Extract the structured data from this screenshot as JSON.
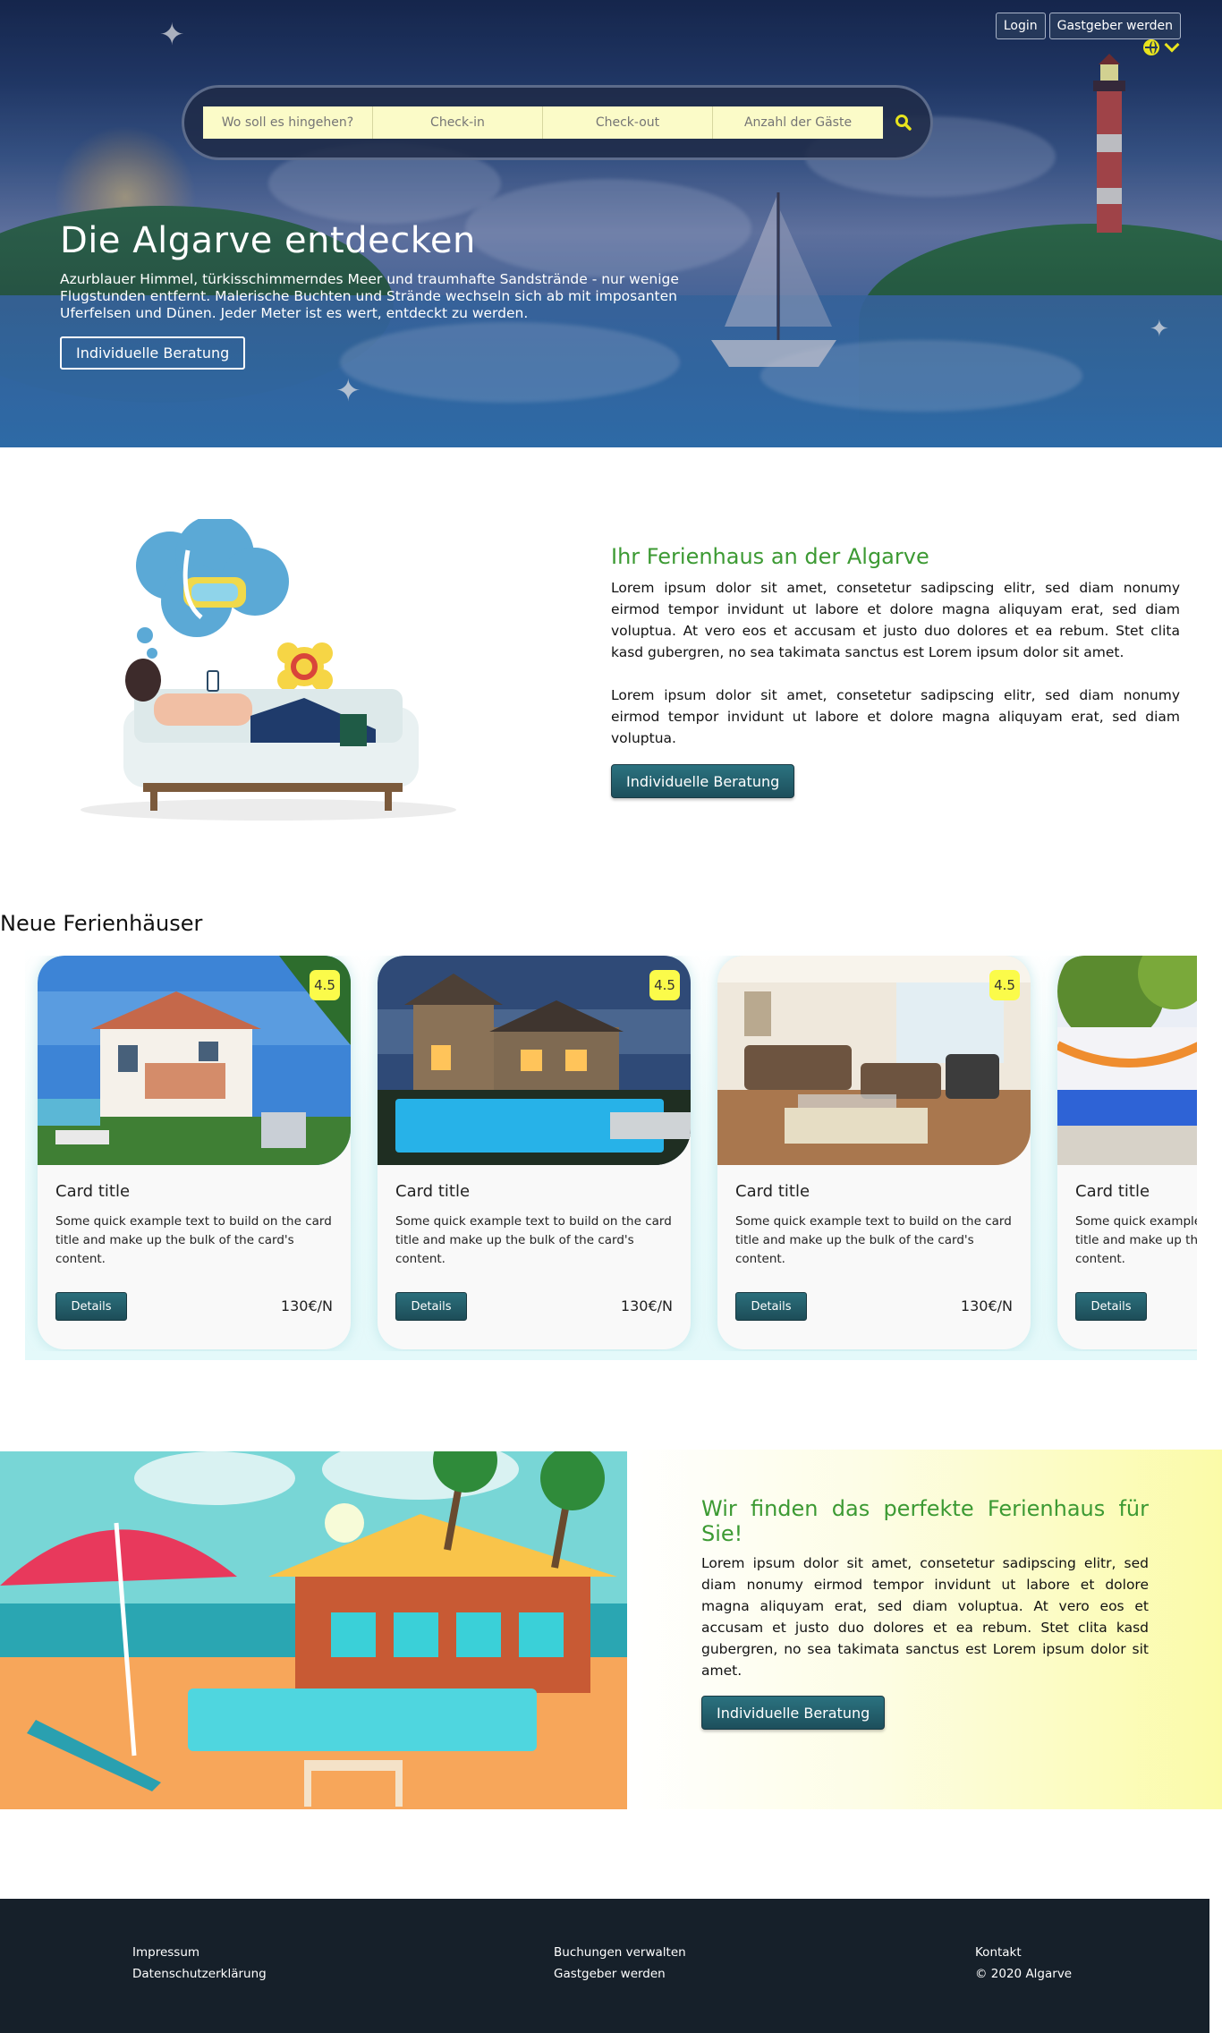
{
  "header": {
    "login_label": "Login",
    "host_label": "Gastgeber werden",
    "language_icon": "globe-icon"
  },
  "search": {
    "destination_placeholder": "Wo soll es hingehen?",
    "checkin_placeholder": "Check-in",
    "checkout_placeholder": "Check-out",
    "guests_placeholder": "Anzahl der Gäste",
    "search_icon": "search-icon"
  },
  "hero": {
    "title": "Die Algarve entdecken",
    "text": "Azurblauer Himmel, türkisschimmerndes Meer und traumhafte Sandstrände - nur wenige Flugstunden entfernt. Malerische Buchten und Strände wechseln sich ab mit imposanten Uferfelsen und Dünen. Jeder Meter ist es wert, entdeckt zu werden.",
    "cta": "Individuelle Beratung"
  },
  "intro": {
    "title": "Ihr Ferienhaus an der Algarve",
    "paragraph1": "Lorem ipsum dolor sit amet, consetetur sadipscing elitr, sed diam nonumy eirmod tempor invidunt ut labore et dolore magna aliquyam erat, sed diam voluptua. At vero eos et accusam et justo duo dolores et ea rebum. Stet clita kasd gubergren, no sea takimata sanctus est Lorem ipsum dolor sit amet.",
    "paragraph2": "Lorem ipsum dolor sit amet, consetetur sadipscing elitr, sed diam nonumy eirmod tempor invidunt ut labore et dolore magna aliquyam erat, sed diam voluptua.",
    "cta": "Individuelle Beratung"
  },
  "listings": {
    "title": "Neue Ferienhäuser",
    "cards": [
      {
        "rating": "4.5",
        "title": "Card title",
        "text": "Some quick example text to build on the card title and make up the bulk of the card's content.",
        "button": "Details",
        "price": "130€/N"
      },
      {
        "rating": "4.5",
        "title": "Card title",
        "text": "Some quick example text to build on the card title and make up the bulk of the card's content.",
        "button": "Details",
        "price": "130€/N"
      },
      {
        "rating": "4.5",
        "title": "Card title",
        "text": "Some quick example text to build on the card title and make up the bulk of the card's content.",
        "button": "Details",
        "price": "130€/N"
      },
      {
        "rating": "",
        "title": "Card title",
        "text": "Some quick example text to build on the card title and make up the bulk of the card's content.",
        "button": "Details",
        "price": ""
      }
    ]
  },
  "perfect": {
    "title": "Wir finden das perfekte Ferienhaus für Sie!",
    "paragraph": "Lorem ipsum dolor sit amet, consetetur sadipscing elitr, sed diam nonumy eirmod tempor invidunt ut labore et dolore magna aliquyam erat, sed diam voluptua. At vero eos et accusam et justo duo dolores et ea rebum. Stet clita kasd gubergren, no sea takimata sanctus est Lorem ipsum dolor sit amet.",
    "cta": "Individuelle Beratung"
  },
  "footer": {
    "col1": [
      "Impressum",
      "Datenschutzerklärung"
    ],
    "col2": [
      "Buchungen verwalten",
      "Gastgeber werden"
    ],
    "col3": [
      "Kontakt",
      "© 2020 Algarve"
    ]
  },
  "colors": {
    "accent_green": "#3c9a33",
    "teal_button": "#2b7280",
    "search_field": "#fbfbc8",
    "badge_yellow": "#fbfb4a",
    "footer_bg": "#16202a",
    "hero_navy": "#25385a"
  }
}
